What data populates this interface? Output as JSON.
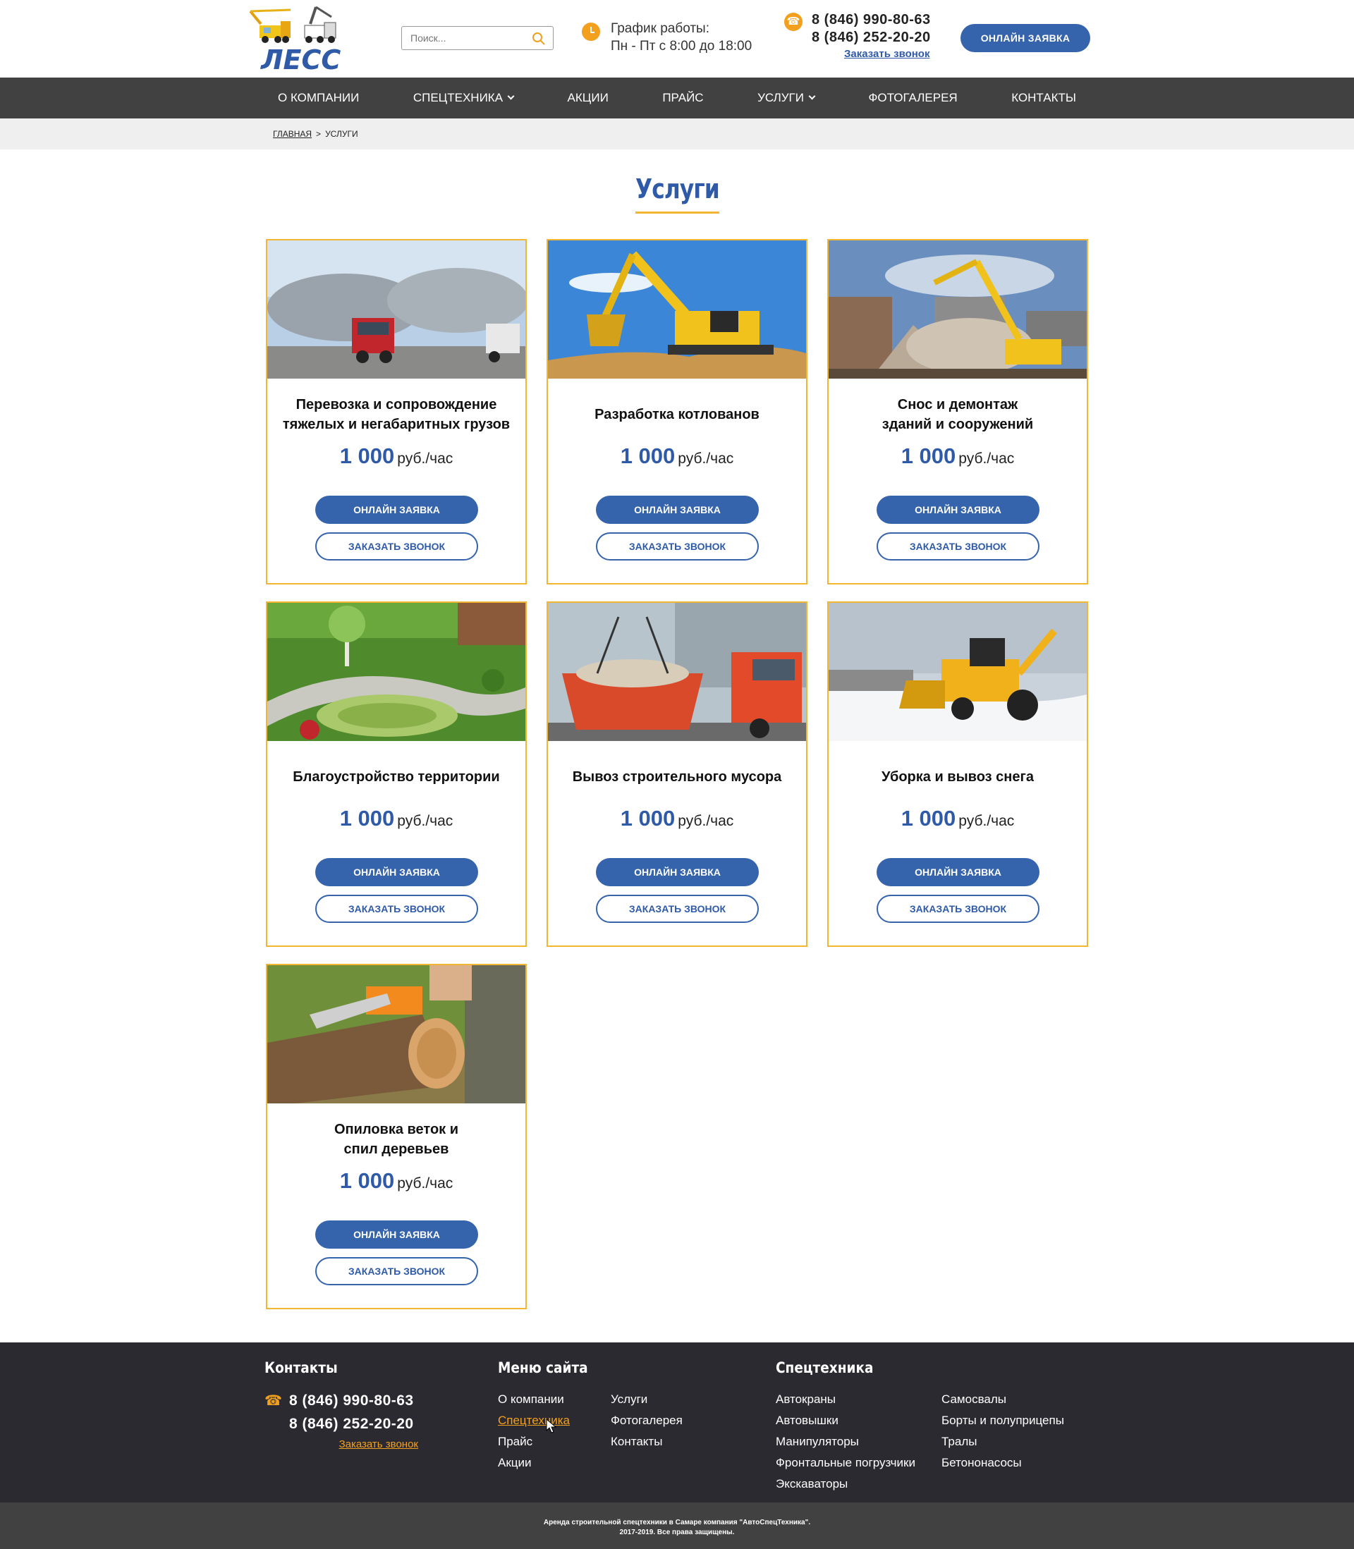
{
  "header": {
    "logo_text": "ЛЕСС",
    "search_placeholder": "Поиск...",
    "schedule_label": "График работы:",
    "schedule_value": "Пн - Пт с 8:00 до 18:00",
    "phone_1": "8 (846) 990-80-63",
    "phone_2": "8 (846) 252-20-20",
    "callback_link": "Заказать звонок",
    "cta_button": "Онлайн заявка"
  },
  "nav": {
    "items": [
      {
        "label": "О компании"
      },
      {
        "label": "Спецтехника"
      },
      {
        "label": "Акции"
      },
      {
        "label": "Прайс"
      },
      {
        "label": "Услуги"
      },
      {
        "label": "Фотогалерея"
      },
      {
        "label": "Контакты"
      }
    ]
  },
  "breadcrumb": {
    "home": "Главная",
    "separator": ">",
    "current": "Услуги"
  },
  "page": {
    "title": "Услуги"
  },
  "cards": [
    {
      "name_1": "Перевозка и сопровождение",
      "name_2": "тяжелых и негабаритных грузов",
      "price": "1 000",
      "unit": "руб./час",
      "btn_order": "Онлайн заявка",
      "btn_call": "Заказать звонок"
    },
    {
      "name_1": "Разработка котлованов",
      "name_2": "",
      "price": "1 000",
      "unit": "руб./час",
      "btn_order": "Онлайн заявка",
      "btn_call": "Заказать звонок"
    },
    {
      "name_1": "Снос и демонтаж",
      "name_2": "зданий и сооружений",
      "price": "1 000",
      "unit": "руб./час",
      "btn_order": "Онлайн заявка",
      "btn_call": "Заказать звонок"
    },
    {
      "name_1": "Благоустройство территории",
      "name_2": "",
      "price": "1 000",
      "unit": "руб./час",
      "btn_order": "Онлайн заявка",
      "btn_call": "Заказать звонок"
    },
    {
      "name_1": "Вывоз строительного мусора",
      "name_2": "",
      "price": "1 000",
      "unit": "руб./час",
      "btn_order": "Онлайн заявка",
      "btn_call": "Заказать звонок"
    },
    {
      "name_1": "Уборка и вывоз снега",
      "name_2": "",
      "price": "1 000",
      "unit": "руб./час",
      "btn_order": "Онлайн заявка",
      "btn_call": "Заказать звонок"
    },
    {
      "name_1": "Опиловка веток и",
      "name_2": "спил деревьев",
      "price": "1 000",
      "unit": "руб./час",
      "btn_order": "Онлайн заявка",
      "btn_call": "Заказать звонок"
    }
  ],
  "footer": {
    "contacts_title": "Контакты",
    "phone_1": "8 (846) 990-80-63",
    "phone_2": "8 (846) 252-20-20",
    "callback_link": "Заказать звонок",
    "menu_title": "Меню сайта",
    "menu_col1": [
      "О компании",
      "Спецтехника",
      "Прайс",
      "Акции"
    ],
    "menu_col2": [
      "Услуги",
      "Фотогалерея",
      "Контакты"
    ],
    "tech_title": "Спецтехника",
    "tech_col1": [
      "Автокраны",
      "Автовышки",
      "Манипуляторы",
      "Фронтальные погрузчики",
      "Экскаваторы"
    ],
    "tech_col2": [
      "Самосвалы",
      "Борты и полуприцепы",
      "Тралы",
      "Бетононасосы"
    ]
  },
  "copyright": {
    "line_1": "Аренда строительной спецтехники в Самаре компания \"АвтоСпецТехника\".",
    "line_2": "2017-2019. Все права защищены."
  },
  "colors": {
    "brand_blue": "#3564ad",
    "accent_yellow": "#f2b632",
    "accent_orange": "#f2a01d",
    "nav_bg": "#414141",
    "footer_bg": "#2b2a30"
  }
}
